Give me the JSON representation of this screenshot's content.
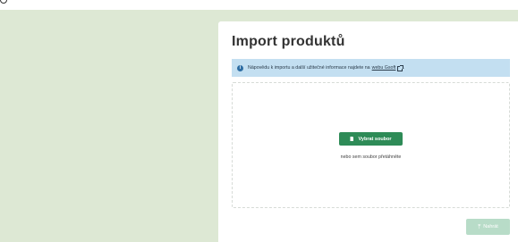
{
  "page": {
    "title": "Import produktů"
  },
  "info": {
    "text": "Nápovědu k importu a další užitečné informace najdete na",
    "link_label": "webu Gsoft",
    "trailing": ".",
    "icon": "info-icon"
  },
  "dropzone": {
    "choose_label": "Vybrat soubor",
    "drag_text": "nebo sem soubor přetáhněte"
  },
  "footer": {
    "upload_label": "Nahrát"
  },
  "colors": {
    "background_panel": "#dde8d4",
    "primary_button": "#2e8b57",
    "disabled_button": "#b8dcc8",
    "info_bar": "#c3dff1"
  }
}
